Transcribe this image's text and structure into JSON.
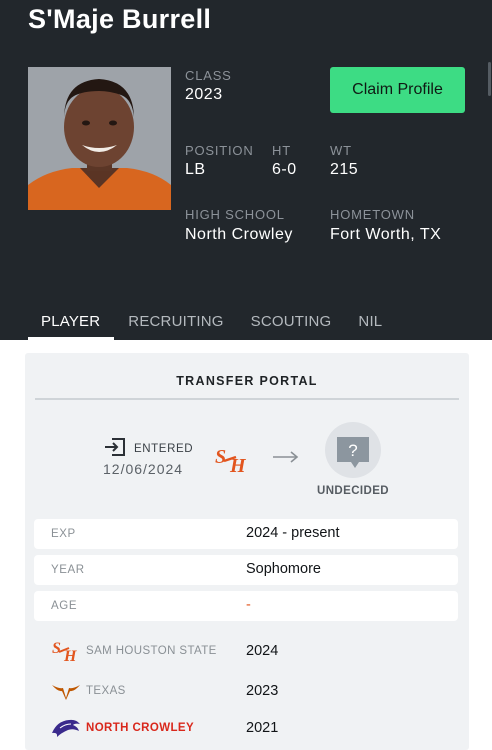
{
  "player": {
    "name": "S'Maje Burrell",
    "class_label": "CLASS",
    "class_value": "2023",
    "position_label": "POSITION",
    "position_value": "LB",
    "ht_label": "HT",
    "ht_value": "6-0",
    "wt_label": "WT",
    "wt_value": "215",
    "high_school_label": "HIGH SCHOOL",
    "high_school_value": "North Crowley",
    "hometown_label": "HOMETOWN",
    "hometown_value": "Fort Worth, TX"
  },
  "actions": {
    "claim_label": "Claim Profile"
  },
  "tabs": [
    {
      "label": "PLAYER",
      "active": true
    },
    {
      "label": "RECRUITING",
      "active": false
    },
    {
      "label": "SCOUTING",
      "active": false
    },
    {
      "label": "NIL",
      "active": false
    }
  ],
  "transfer_portal": {
    "title": "TRANSFER PORTAL",
    "entered_label": "ENTERED",
    "entered_date": "12/06/2024",
    "from_school_logo_text": "SH",
    "destination_label": "UNDECIDED",
    "destination_icon_text": "?"
  },
  "details": [
    {
      "key": "EXP",
      "value": "2024 - present"
    },
    {
      "key": "YEAR",
      "value": "Sophomore"
    },
    {
      "key": "AGE",
      "value": "-"
    }
  ],
  "history": [
    {
      "school": "SAM HOUSTON STATE",
      "year": "2024",
      "logo": "shsu-logo-icon"
    },
    {
      "school": "TEXAS",
      "year": "2023",
      "logo": "longhorn-logo-icon"
    },
    {
      "school": "NORTH CROWLEY",
      "year": "2021",
      "logo": "panther-logo-icon"
    }
  ],
  "colors": {
    "header_bg": "#22272c",
    "accent_green": "#3ddc84",
    "shsu_orange": "#e2551e",
    "texas_orange": "#bf5700",
    "north_crowley_red": "#d9281c",
    "north_crowley_blue": "#3a2a8c"
  }
}
